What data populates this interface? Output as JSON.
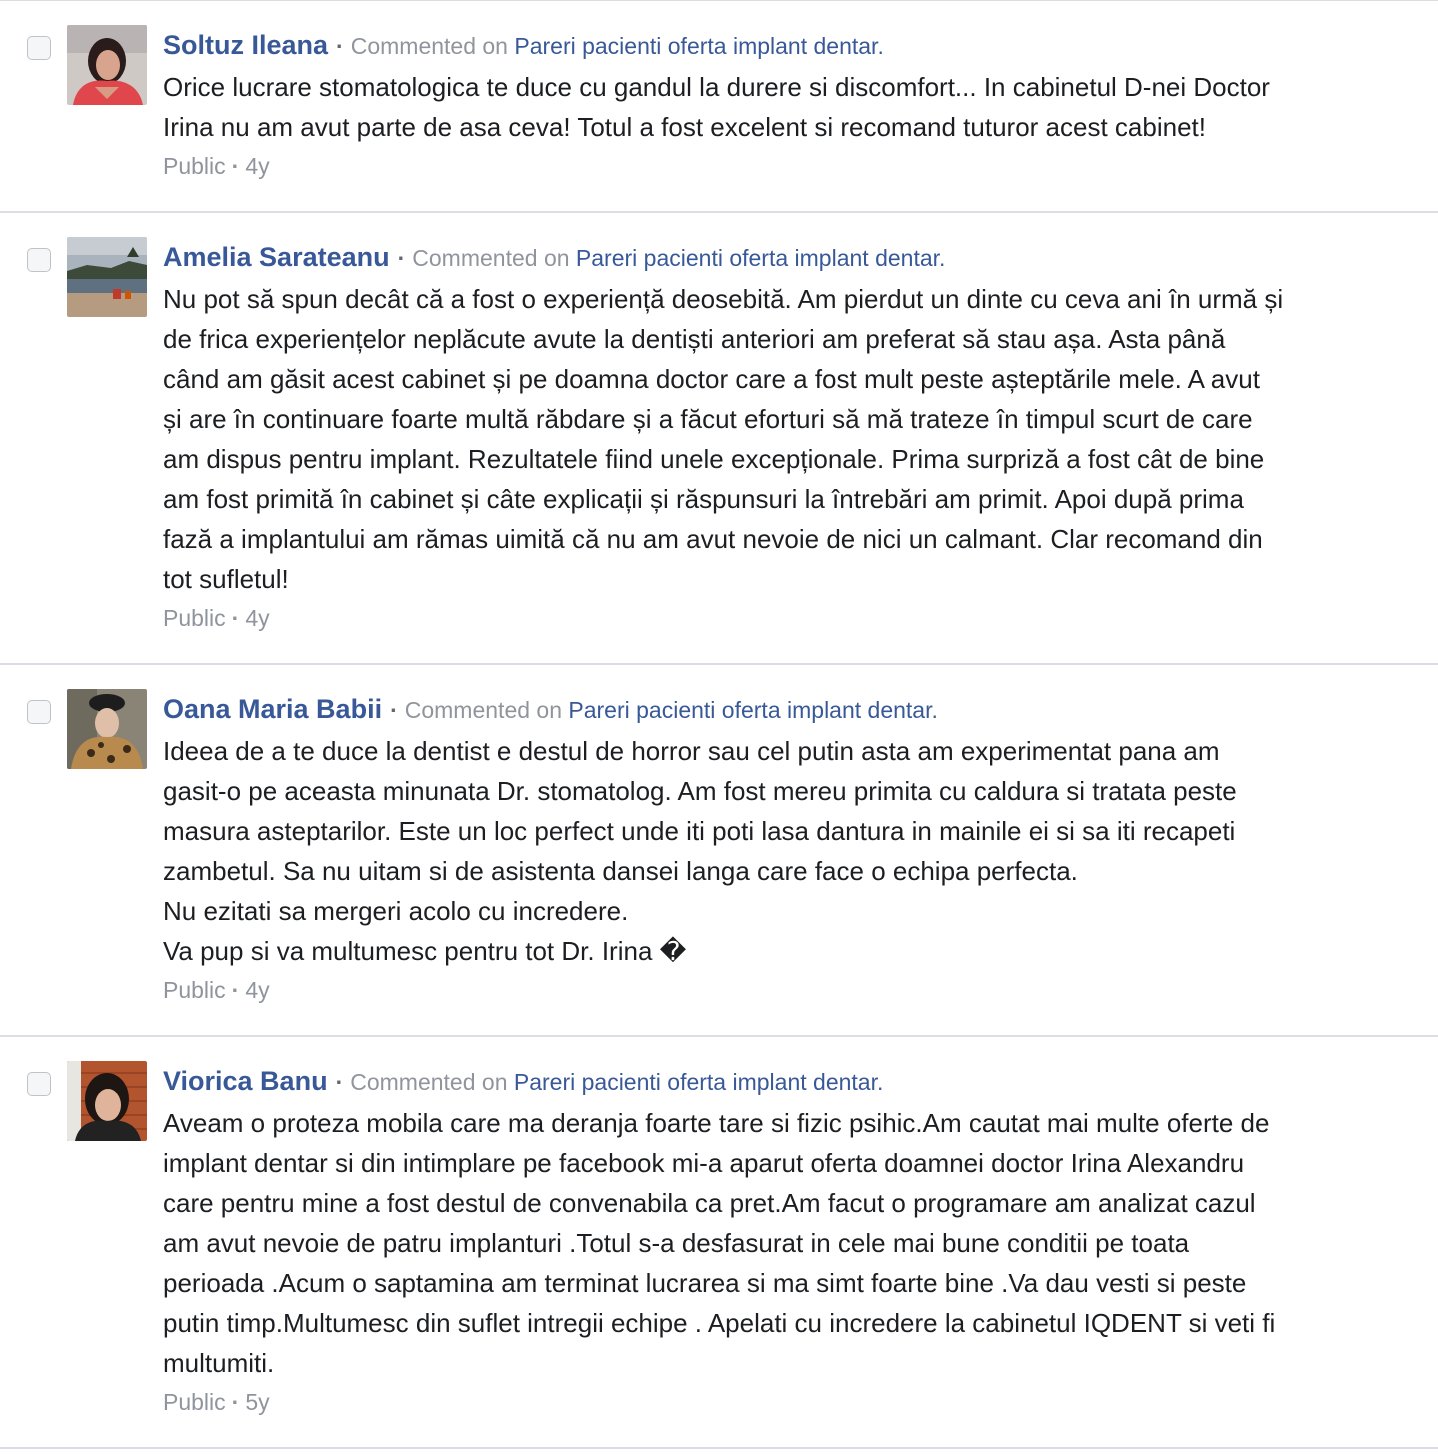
{
  "comments": [
    {
      "author": "Soltuz Ileana",
      "action": "Commented on",
      "target": "Pareri pacienti oferta implant dentar.",
      "text": "Orice lucrare stomatologica te duce cu gandul la durere si discomfort... In cabinetul D-nei Doctor\nIrina nu am avut parte de asa ceva! Totul a fost excelent si recomand tuturor acest cabinet!",
      "privacy": "Public",
      "age": "4y"
    },
    {
      "author": "Amelia Sarateanu",
      "action": "Commented on",
      "target": "Pareri pacienti oferta implant dentar.",
      "text": "Nu pot să spun decât că a fost o experiență deosebită. Am pierdut un dinte cu ceva ani în urmă și\nde frica experiențelor neplăcute avute la dentiști anteriori am preferat să stau așa. Asta până\ncând am găsit acest cabinet și pe doamna doctor care a fost mult peste așteptările mele. A avut\nși are în continuare foarte multă răbdare și a făcut eforturi să mă trateze în timpul scurt de care\nam dispus pentru implant. Rezultatele fiind unele excepționale. Prima surpriză a fost cât de bine\nam fost primită în cabinet și câte explicații și răspunsuri la întrebări am primit. Apoi după prima\nfază a implantului am rămas uimită că nu am avut nevoie de nici un calmant. Clar recomand din\ntot sufletul!",
      "privacy": "Public",
      "age": "4y"
    },
    {
      "author": "Oana Maria Babii",
      "action": "Commented on",
      "target": "Pareri pacienti oferta implant dentar.",
      "text": "Ideea de a te duce la dentist e destul de horror sau cel putin asta am experimentat pana am\ngasit-o pe aceasta minunata Dr. stomatolog. Am fost mereu primita cu caldura si tratata peste\nmasura asteptarilor. Este un loc perfect unde iti poti lasa dantura in mainile ei si sa iti recapeti\nzambetul. Sa nu uitam si de asistenta dansei langa care face o echipa perfecta.\nNu ezitati sa mergeri acolo cu incredere.\nVa pup si va multumesc pentru tot Dr. Irina �",
      "privacy": "Public",
      "age": "4y"
    },
    {
      "author": "Viorica Banu",
      "action": "Commented on",
      "target": "Pareri pacienti oferta implant dentar.",
      "text": "Aveam o proteza mobila care ma deranja foarte tare si fizic psihic.Am cautat mai multe oferte de\nimplant dentar si din intimplare pe facebook mi-a aparut oferta doamnei doctor Irina Alexandru\ncare pentru mine a fost destul de convenabila ca pret.Am facut o programare am analizat cazul\nam avut nevoie de patru implanturi .Totul s-a desfasurat in cele mai bune conditii pe toata\nperioada .Acum o saptamina am terminat lucrarea si ma simt foarte bine .Va dau vesti si peste\nputin timp.Multumesc din suflet intregii echipe . Apelati cu incredere la cabinetul IQDENT si veti fi\nmultumiti.",
      "privacy": "Public",
      "age": "5y"
    }
  ]
}
